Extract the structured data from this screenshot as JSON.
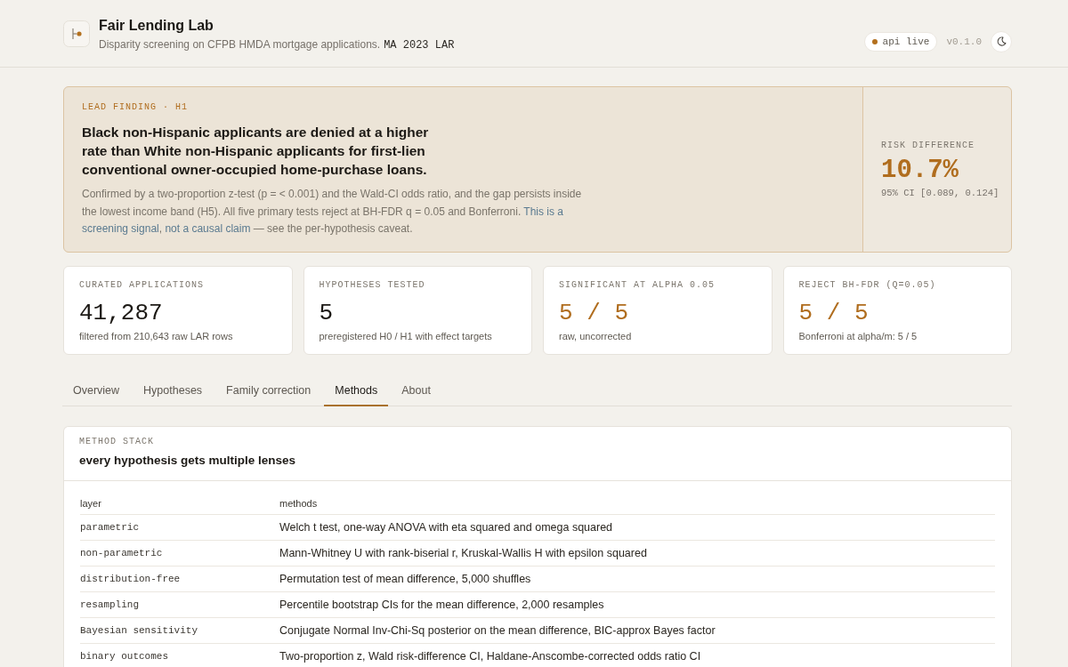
{
  "header": {
    "title": "Fair Lending Lab",
    "subtitle": "Disparity screening on CFPB HMDA mortgage applications.",
    "dataset": "MA 2023 LAR",
    "status": "api live",
    "version": "v0.1.0"
  },
  "lead_finding": {
    "eyebrow": "LEAD FINDING · H1",
    "headline": "Black non-Hispanic applicants are denied at a higher rate than White non-Hispanic applicants for first-lien conventional owner-occupied home-purchase loans.",
    "body": [
      {
        "kind": "plain",
        "text": "Confirmed by a two-proportion z-test (p = < 0.001) and the Wald-CI odds ratio, and the gap persists inside the lowest income band (H5). All five primary tests reject at BH-FDR q = 0.05 and Bonferroni. "
      },
      {
        "kind": "emphasis",
        "text": "This is a screening signal"
      },
      {
        "kind": "plain",
        "text": ", "
      },
      {
        "kind": "emphasis",
        "text": "not a causal claim"
      },
      {
        "kind": "plain",
        "text": " — see the per-hypothesis caveat."
      }
    ],
    "metric": {
      "label": "RISK DIFFERENCE",
      "value": "10.7%",
      "ci": "95% CI [0.089, 0.124]"
    }
  },
  "stats": [
    {
      "label": "CURATED APPLICATIONS",
      "value": "41,287",
      "note": "filtered from 210,643 raw LAR rows",
      "accent": false
    },
    {
      "label": "HYPOTHESES TESTED",
      "value": "5",
      "note": "preregistered H0 / H1 with effect targets",
      "accent": false
    },
    {
      "label": "SIGNIFICANT AT ALPHA 0.05",
      "value": "5 / 5",
      "note": "raw, uncorrected",
      "accent": true
    },
    {
      "label": "REJECT BH-FDR (Q=0.05)",
      "value": "5 / 5",
      "note": "Bonferroni at alpha/m: 5 / 5",
      "accent": true
    }
  ],
  "tabs": [
    {
      "label": "Overview",
      "selected": false
    },
    {
      "label": "Hypotheses",
      "selected": false
    },
    {
      "label": "Family correction",
      "selected": false
    },
    {
      "label": "Methods",
      "selected": true
    },
    {
      "label": "About",
      "selected": false
    }
  ],
  "methods": {
    "eyebrow": "METHOD STACK",
    "title": "every hypothesis gets multiple lenses",
    "table": {
      "columns": [
        "layer",
        "methods"
      ],
      "rows": [
        [
          "parametric",
          "Welch t test, one-way ANOVA with eta squared and omega squared"
        ],
        [
          "non-parametric",
          "Mann-Whitney U with rank-biserial r, Kruskal-Wallis H with epsilon squared"
        ],
        [
          "distribution-free",
          "Permutation test of mean difference, 5,000 shuffles"
        ],
        [
          "resampling",
          "Percentile bootstrap CIs for the mean difference, 2,000 resamples"
        ],
        [
          "Bayesian sensitivity",
          "Conjugate Normal Inv-Chi-Sq posterior on the mean difference, BIC-approx Bayes factor"
        ],
        [
          "binary outcomes",
          "Two-proportion z, Wald risk-difference CI, Haldane-Anscombe-corrected odds ratio CI"
        ]
      ]
    }
  }
}
